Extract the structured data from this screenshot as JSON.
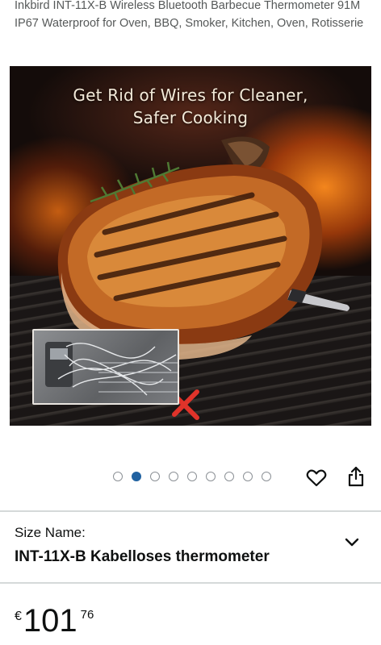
{
  "product": {
    "title": "Inkbird INT-11X-B Wireless Bluetooth Barbecue Thermometer 91M IP67 Waterproof for Oven, BBQ, Smoker, Kitchen, Oven, Rotisserie"
  },
  "gallery": {
    "headline_line1": "Get Rid of Wires for Cleaner,",
    "headline_line2": "Safer Cooking",
    "dot_count": 9,
    "active_index": 1,
    "wishlist_icon": "heart-icon",
    "share_icon": "share-icon"
  },
  "size": {
    "label": "Size Name:",
    "value": "INT-11X-B Kabelloses thermometer",
    "chevron_icon": "chevron-down-icon"
  },
  "price": {
    "currency": "€",
    "whole": "101",
    "fraction": "76"
  },
  "colors": {
    "active_dot": "#2162a1",
    "inactive_dot_border": "#8c9196",
    "divider": "#d5d9d9",
    "text": "#0f1111",
    "title_text": "#565959",
    "cross_mark": "#e0332a"
  }
}
